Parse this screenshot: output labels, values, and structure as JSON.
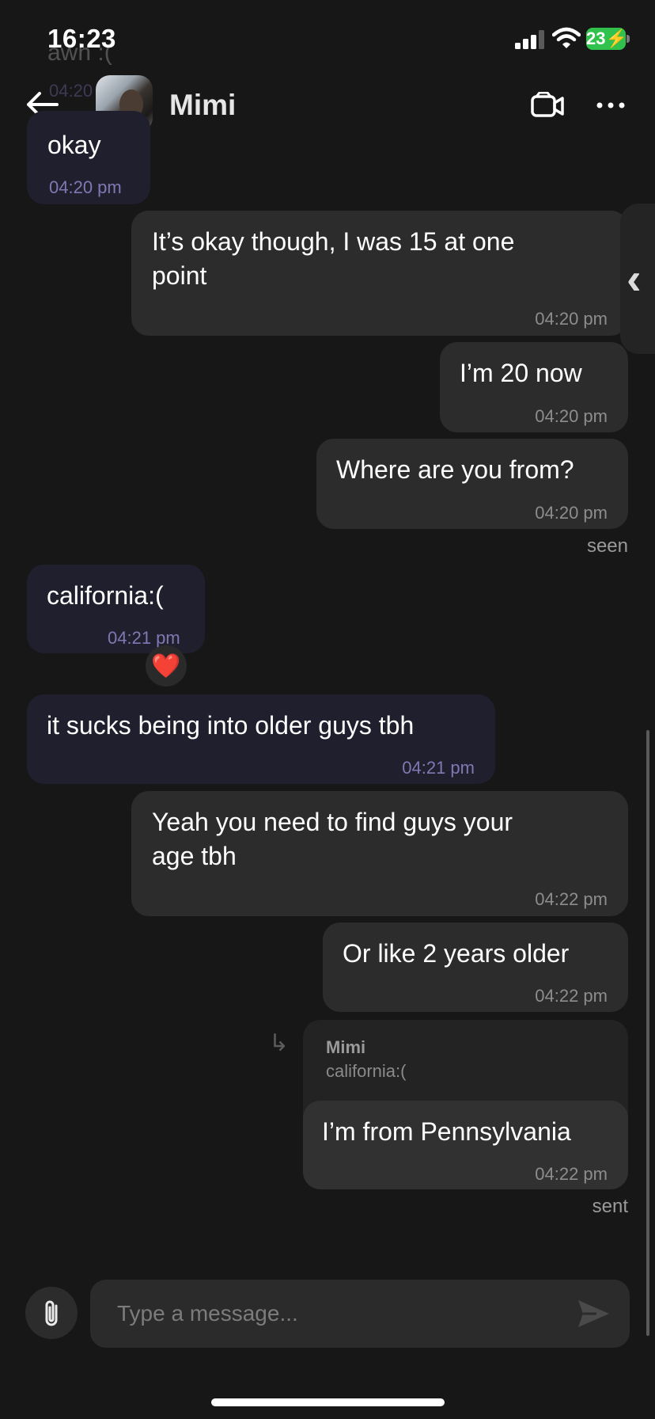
{
  "status_bar": {
    "time": "16:23",
    "battery": "23"
  },
  "header": {
    "ghost_text": "awh :(",
    "ghost_time": "04:20",
    "contact_name": "Mimi"
  },
  "messages": [
    {
      "text": "okay",
      "time": "04:20 pm",
      "direction": "received"
    },
    {
      "text_lines": [
        "It’s okay though, I was 15 at one",
        "point"
      ],
      "time": "04:20 pm",
      "direction": "sent"
    },
    {
      "text": "I’m 20 now",
      "time": "04:20 pm",
      "direction": "sent"
    },
    {
      "text": "Where are you from?",
      "time": "04:20 pm",
      "direction": "sent",
      "status": "seen"
    },
    {
      "text": "california:(",
      "time": "04:21 pm",
      "direction": "received",
      "reaction": "❤️"
    },
    {
      "text": "it sucks being into older guys tbh",
      "time": "04:21 pm",
      "direction": "received"
    },
    {
      "text_lines": [
        "Yeah you need to find guys your",
        "age tbh"
      ],
      "time": "04:22 pm",
      "direction": "sent"
    },
    {
      "text": "Or like 2 years older",
      "time": "04:22 pm",
      "direction": "sent"
    },
    {
      "reply_to": {
        "name": "Mimi",
        "text": "california:("
      },
      "text": "I’m from Pennsylvania",
      "time": "04:22 pm",
      "direction": "sent",
      "status": "sent"
    }
  ],
  "composer": {
    "placeholder": "Type a message..."
  },
  "icons": {
    "back": "arrow-left-icon",
    "video": "video-camera-icon",
    "more": "more-horizontal-icon",
    "side_tab": "chevron-left-icon",
    "attach": "paperclip-icon",
    "send": "send-icon"
  },
  "colors": {
    "background": "#171717",
    "received_bubble": "#201f2d",
    "sent_bubble": "#2c2c2c",
    "received_time": "#7f79b3",
    "battery": "#30c24c"
  }
}
